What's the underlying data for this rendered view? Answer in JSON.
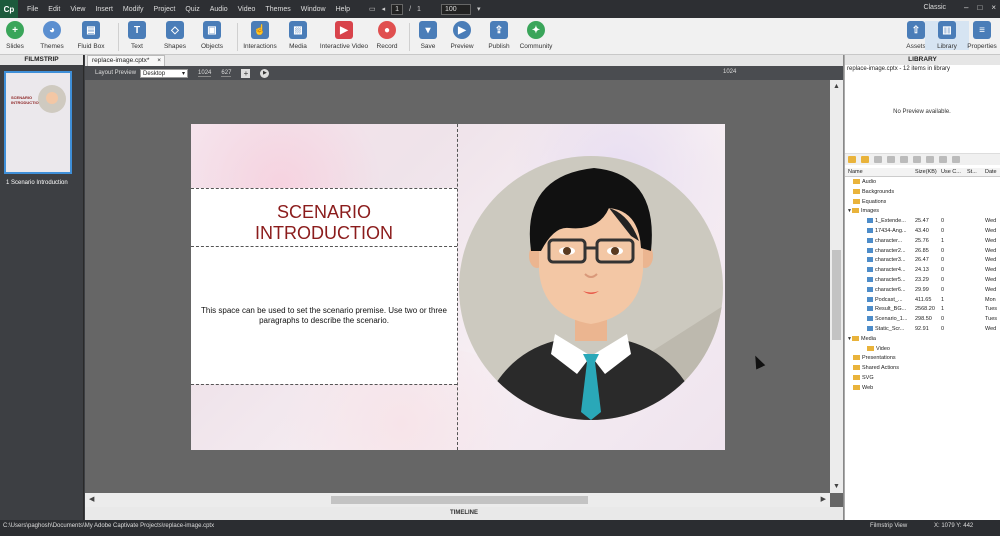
{
  "app": {
    "logo": "Cp"
  },
  "menubar": {
    "items": [
      "File",
      "Edit",
      "View",
      "Insert",
      "Modify",
      "Project",
      "Quiz",
      "Audio",
      "Video",
      "Themes",
      "Window",
      "Help"
    ],
    "slide_current": "1",
    "slide_sep": "/",
    "slide_total": "1",
    "zoom": "100",
    "workspace": "Classic"
  },
  "toolbar": {
    "slides": "Slides",
    "themes": "Themes",
    "fluid_box": "Fluid Box",
    "text": "Text",
    "shapes": "Shapes",
    "objects": "Objects",
    "interactions": "Interactions",
    "media": "Media",
    "interactive_video": "Interactive Video",
    "record": "Record",
    "save": "Save",
    "preview": "Preview",
    "publish": "Publish",
    "community": "Community",
    "assets": "Assets",
    "library": "Library",
    "properties": "Properties"
  },
  "filmstrip": {
    "title": "FILMSTRIP",
    "slide_label": "1 Scenario Introduction",
    "thumb_text": "SCENARIO INTRODUCTION"
  },
  "document": {
    "tab_name": "replace-image.cptx*",
    "tab_close": "×",
    "layout_preview_label": "Layout Preview",
    "layout_mode": "Desktop",
    "width": "1024",
    "height": "627",
    "ruler_position": "1024"
  },
  "slide": {
    "title_line1": "SCENARIO",
    "title_line2": "INTRODUCTION",
    "body": "This space can be used to set the scenario premise. Use two or three paragraphs to describe the scenario."
  },
  "timeline": {
    "label": "TIMELINE"
  },
  "library": {
    "title": "LIBRARY",
    "info": "replace-image.cptx - 12 items in library",
    "no_preview": "No Preview available.",
    "columns": [
      "Name",
      "Size(KB)",
      "Use C...",
      "St...",
      "Date"
    ],
    "folders": [
      {
        "name": "Audio",
        "expanded": false
      },
      {
        "name": "Backgrounds",
        "expanded": false
      },
      {
        "name": "Equations",
        "expanded": false
      },
      {
        "name": "Images",
        "expanded": true
      }
    ],
    "images": [
      {
        "name": "1_Extende...",
        "size": "25.47",
        "use": "0",
        "date": "Wed"
      },
      {
        "name": "17434-Ang...",
        "size": "43.40",
        "use": "0",
        "date": "Wed"
      },
      {
        "name": "character...",
        "size": "25.76",
        "use": "1",
        "date": "Wed"
      },
      {
        "name": "character2...",
        "size": "26.85",
        "use": "0",
        "date": "Wed"
      },
      {
        "name": "character3...",
        "size": "26.47",
        "use": "0",
        "date": "Wed"
      },
      {
        "name": "character4...",
        "size": "24.13",
        "use": "0",
        "date": "Wed"
      },
      {
        "name": "character5...",
        "size": "23.29",
        "use": "0",
        "date": "Wed"
      },
      {
        "name": "character6...",
        "size": "29.99",
        "use": "0",
        "date": "Wed"
      },
      {
        "name": "Podcast_...",
        "size": "411.65",
        "use": "1",
        "date": "Mon"
      },
      {
        "name": "Result_BG...",
        "size": "2568.20",
        "use": "1",
        "date": "Tues"
      },
      {
        "name": "Scenario_1...",
        "size": "298.50",
        "use": "0",
        "date": "Tues"
      },
      {
        "name": "Static_Scr...",
        "size": "92.91",
        "use": "0",
        "date": "Wed"
      }
    ],
    "media_folder": "Media",
    "media_sub": "Video",
    "other_folders": [
      "Presentations",
      "Shared Actions",
      "SVG",
      "Web"
    ]
  },
  "statusbar": {
    "path": "C:\\Users\\paghosh\\Documents\\My Adobe Captivate Projects\\replace-image.cptx",
    "view": "Filmstrip View",
    "coords": "X: 1079 Y: 442"
  },
  "colors": {
    "title_red": "#8b1c1c",
    "accent_blue": "#3f8fd8",
    "tie_teal": "#2aa8b8"
  }
}
